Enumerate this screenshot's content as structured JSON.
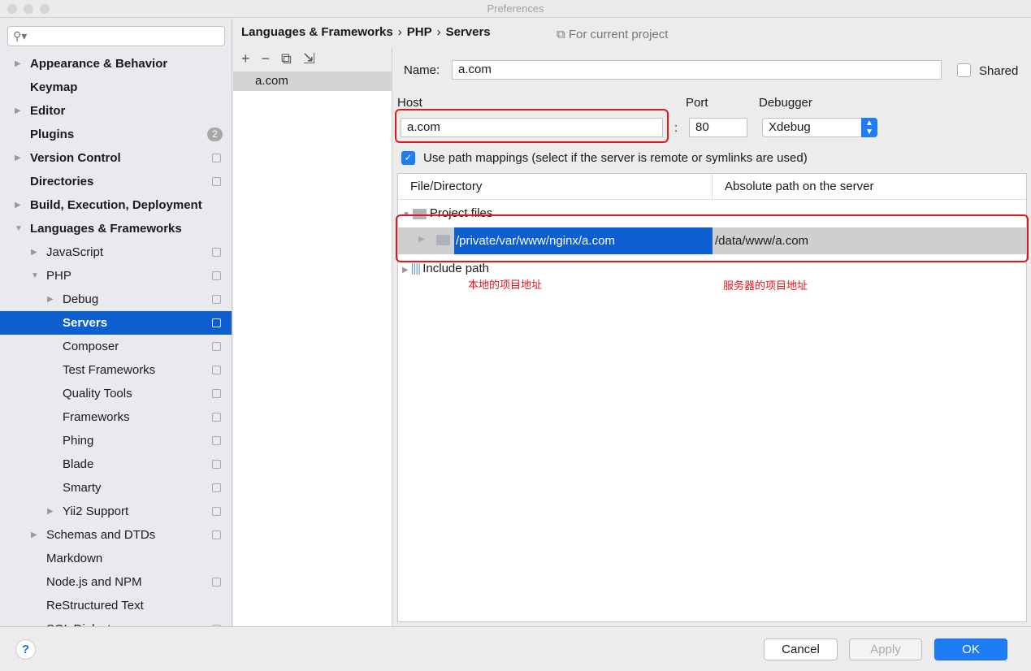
{
  "window": {
    "title": "Preferences"
  },
  "sidebar": {
    "items": [
      {
        "label": "Appearance & Behavior",
        "level": 0,
        "arrow": "right",
        "bold": true,
        "icon": false
      },
      {
        "label": "Keymap",
        "level": 0,
        "arrow": "",
        "bold": true,
        "icon": false
      },
      {
        "label": "Editor",
        "level": 0,
        "arrow": "right",
        "bold": true,
        "icon": false
      },
      {
        "label": "Plugins",
        "level": 0,
        "arrow": "",
        "bold": true,
        "icon": false,
        "badge": "2"
      },
      {
        "label": "Version Control",
        "level": 0,
        "arrow": "right",
        "bold": true,
        "icon": true
      },
      {
        "label": "Directories",
        "level": 0,
        "arrow": "",
        "bold": true,
        "icon": true
      },
      {
        "label": "Build, Execution, Deployment",
        "level": 0,
        "arrow": "right",
        "bold": true,
        "icon": false
      },
      {
        "label": "Languages & Frameworks",
        "level": 0,
        "arrow": "down",
        "bold": true,
        "icon": false
      },
      {
        "label": "JavaScript",
        "level": 1,
        "arrow": "right",
        "bold": false,
        "icon": true
      },
      {
        "label": "PHP",
        "level": 1,
        "arrow": "down",
        "bold": false,
        "icon": true
      },
      {
        "label": "Debug",
        "level": 2,
        "arrow": "right",
        "bold": false,
        "icon": true
      },
      {
        "label": "Servers",
        "level": 2,
        "arrow": "",
        "bold": true,
        "icon": true,
        "selected": true
      },
      {
        "label": "Composer",
        "level": 2,
        "arrow": "",
        "bold": false,
        "icon": true
      },
      {
        "label": "Test Frameworks",
        "level": 2,
        "arrow": "",
        "bold": false,
        "icon": true
      },
      {
        "label": "Quality Tools",
        "level": 2,
        "arrow": "",
        "bold": false,
        "icon": true
      },
      {
        "label": "Frameworks",
        "level": 2,
        "arrow": "",
        "bold": false,
        "icon": true
      },
      {
        "label": "Phing",
        "level": 2,
        "arrow": "",
        "bold": false,
        "icon": true
      },
      {
        "label": "Blade",
        "level": 2,
        "arrow": "",
        "bold": false,
        "icon": true
      },
      {
        "label": "Smarty",
        "level": 2,
        "arrow": "",
        "bold": false,
        "icon": true
      },
      {
        "label": "Yii2 Support",
        "level": 2,
        "arrow": "right",
        "bold": false,
        "icon": true
      },
      {
        "label": "Schemas and DTDs",
        "level": 1,
        "arrow": "right",
        "bold": false,
        "icon": true
      },
      {
        "label": "Markdown",
        "level": 1,
        "arrow": "",
        "bold": false,
        "icon": false
      },
      {
        "label": "Node.js and NPM",
        "level": 1,
        "arrow": "",
        "bold": false,
        "icon": true
      },
      {
        "label": "ReStructured Text",
        "level": 1,
        "arrow": "",
        "bold": false,
        "icon": false
      },
      {
        "label": "SQL Dialects",
        "level": 1,
        "arrow": "",
        "bold": false,
        "icon": true
      }
    ]
  },
  "breadcrumb": [
    "Languages & Frameworks",
    "PHP",
    "Servers"
  ],
  "scope": "For current project",
  "servers": [
    "a.com"
  ],
  "form": {
    "name_label": "Name:",
    "name": "a.com",
    "shared_label": "Shared",
    "host_label": "Host",
    "host": "a.com",
    "port_label": "Port",
    "port": "80",
    "debugger_label": "Debugger",
    "debugger": "Xdebug",
    "use_mappings": "Use path mappings (select if the server is remote or symlinks are used)",
    "use_mappings_checked": true
  },
  "mappings": {
    "col1": "File/Directory",
    "col2": "Absolute path on the server",
    "project_files": "Project files",
    "local": "/private/var/www/nginx/a.com",
    "remote": "/data/www/a.com",
    "include_path": "Include path"
  },
  "annotations": {
    "local": "本地的项目地址",
    "remote": "服务器的项目地址"
  },
  "buttons": {
    "help": "?",
    "cancel": "Cancel",
    "apply": "Apply",
    "ok": "OK"
  },
  "colors": {
    "accent": "#0d5ece",
    "annotation": "#e8141b"
  }
}
